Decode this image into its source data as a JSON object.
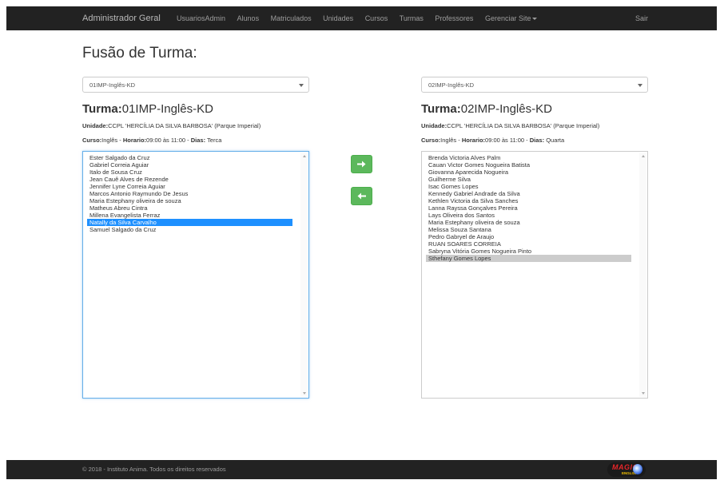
{
  "navbar": {
    "brand": "Administrador Geral",
    "items": [
      "UsuariosAdmin",
      "Alunos",
      "Matriculados",
      "Unidades",
      "Cursos",
      "Turmas",
      "Professores"
    ],
    "dropdown": "Gerenciar Site",
    "logout": "Sair"
  },
  "page": {
    "title": "Fusão de Turma:"
  },
  "left": {
    "select_value": "01IMP-Inglês-KD",
    "turma_label": "Turma:",
    "turma_value": "01IMP-Inglês-KD",
    "unidade_label": "Unidade:",
    "unidade_value": "CCPL 'HERCÍLIA DA SILVA BARBOSA' (Parque Imperial)",
    "curso_label": "Curso:",
    "curso_value": "Inglês - ",
    "horario_label": "Horario:",
    "horario_value": "09:00 às 11:00 - ",
    "dias_label": "Dias:",
    "dias_value": " Terca",
    "students": [
      "Ester Salgado da Cruz",
      "Gabriel Correia Aguiar",
      "Italo de Sousa Cruz",
      "Jean Cauê Alves de Rezende",
      "Jennifer Lyne Correia Aguiar",
      "Marcos Antonio Raymundo De Jesus",
      "Maria Estephany oliveira de souza",
      "Matheus Abreu Cintra",
      "Millena Evangelista Ferraz",
      "Natally da Silva Carvalho",
      "Samuel Salgado da Cruz"
    ],
    "selected_index": 9
  },
  "right": {
    "select_value": "02IMP-Inglês-KD",
    "turma_label": "Turma:",
    "turma_value": "02IMP-Inglês-KD",
    "unidade_label": "Unidade:",
    "unidade_value": "CCPL 'HERCÍLIA DA SILVA BARBOSA' (Parque Imperial)",
    "curso_label": "Curso:",
    "curso_value": "Inglês - ",
    "horario_label": "Horario:",
    "horario_value": "09:00 às 11:00 - ",
    "dias_label": "Dias:",
    "dias_value": " Quarta",
    "students": [
      "Brenda Victoria Alves Palm",
      "Cauan Victor Gomes Nogueira Batista",
      "Giovanna Aparecida Nogueira",
      "Guilherme Silva",
      "Isac Gomes Lopes",
      "Kennedy Gabriel Andrade da Silva",
      "Kethlen Victoria da Silva Sanches",
      "Lanna Rayssa Gonçalves Pereira",
      "Lays Oliveira dos Santos",
      "Maria Estephany oliveira de souza",
      "Melissa Souza Santana",
      "Pedro Gabryel de Araujo",
      "RUAN SOARES CORREIA",
      "Sabryna Vitória Gomes Nogueira Pinto",
      "Sthefany Gomes Lopes"
    ],
    "selected_index": 14
  },
  "buttons": {
    "move_right_icon": "arrow-right-icon",
    "move_left_icon": "arrow-left-icon"
  },
  "colors": {
    "accent_green": "#5cb85c",
    "selected_blue": "#1e90ff",
    "navbar": "#222222"
  },
  "footer": {
    "copyright": "© 2018 - Instituto Anima. Todos os direitos reservados",
    "logo_text": "MAGIC",
    "logo_sub": "ENGLISH"
  }
}
